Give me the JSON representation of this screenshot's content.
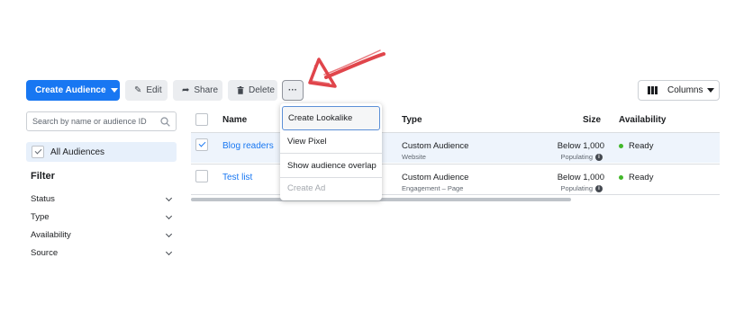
{
  "toolbar": {
    "create_label": "Create Audience",
    "edit_label": "Edit",
    "share_label": "Share",
    "delete_label": "Delete",
    "more_label": "···",
    "columns_label": "Columns"
  },
  "sidebar": {
    "search_placeholder": "Search by name or audience ID",
    "all_audiences": "All Audiences",
    "filter_title": "Filter",
    "filters": [
      "Status",
      "Type",
      "Availability",
      "Source"
    ]
  },
  "table": {
    "headers": {
      "name": "Name",
      "type": "Type",
      "size": "Size",
      "availability": "Availability"
    },
    "rows": [
      {
        "name": "Blog readers",
        "type": "Custom Audience",
        "subtype": "Website",
        "size": "Below 1,000",
        "size_status": "Populating",
        "availability": "Ready",
        "selected": true
      },
      {
        "name": "Test list",
        "type": "Custom Audience",
        "subtype": "Engagement – Page",
        "size": "Below 1,000",
        "size_status": "Populating",
        "availability": "Ready",
        "selected": false
      }
    ]
  },
  "menu": {
    "items": [
      "Create Lookalike",
      "View Pixel",
      "Show audience overlap",
      "Create Ad"
    ]
  },
  "colors": {
    "primary": "#1877f2",
    "arrow": "#e0454b",
    "ready_dot": "#42b72a"
  }
}
